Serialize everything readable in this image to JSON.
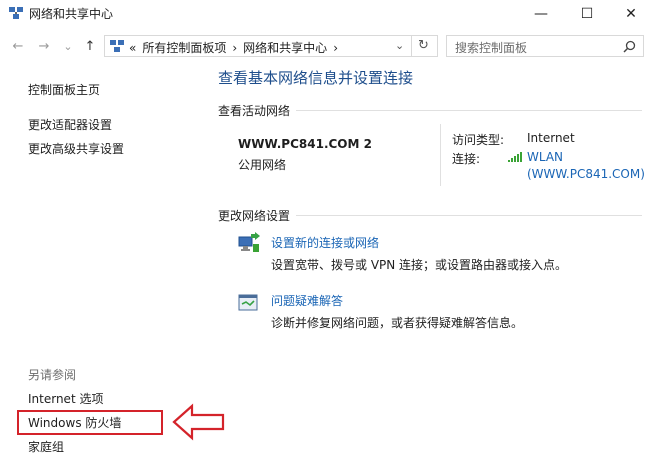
{
  "window": {
    "title": "网络和共享中心",
    "controls": {
      "minimize": "—",
      "maximize": "☐",
      "close": "✕"
    }
  },
  "navbar": {
    "back": "←",
    "forward": "→",
    "dropdown": "⌄",
    "up": "↑",
    "breadcrumb": [
      "«",
      "所有控制面板项",
      "›",
      "网络和共享中心",
      "›"
    ],
    "refresh": "↻",
    "search_placeholder": "搜索控制面板",
    "search_icon": "search-icon"
  },
  "sidebar": {
    "home": "控制面板主页",
    "links": [
      "更改适配器设置",
      "更改高级共享设置"
    ],
    "see_also_label": "另请参阅",
    "see_also": [
      "Internet 选项",
      "Windows 防火墙",
      "家庭组"
    ]
  },
  "main": {
    "heading": "查看基本网络信息并设置连接",
    "active_networks_label": "查看活动网络",
    "network": {
      "name": "WWW.PC841.COM  2",
      "type": "公用网络",
      "access_type_label": "访问类型:",
      "access_type_value": "Internet",
      "connections_label": "连接:",
      "connection_name": "WLAN",
      "connection_detail": "(WWW.PC841.COM)"
    },
    "change_settings_label": "更改网络设置",
    "tasks": [
      {
        "title": "设置新的连接或网络",
        "desc": "设置宽带、拨号或 VPN 连接；或设置路由器或接入点。"
      },
      {
        "title": "问题疑难解答",
        "desc": "诊断并修复网络问题，或者获得疑难解答信息。"
      }
    ]
  },
  "colors": {
    "accent_link": "#1a65b5",
    "heading": "#1e4e8c",
    "highlight": "#d4232a"
  }
}
